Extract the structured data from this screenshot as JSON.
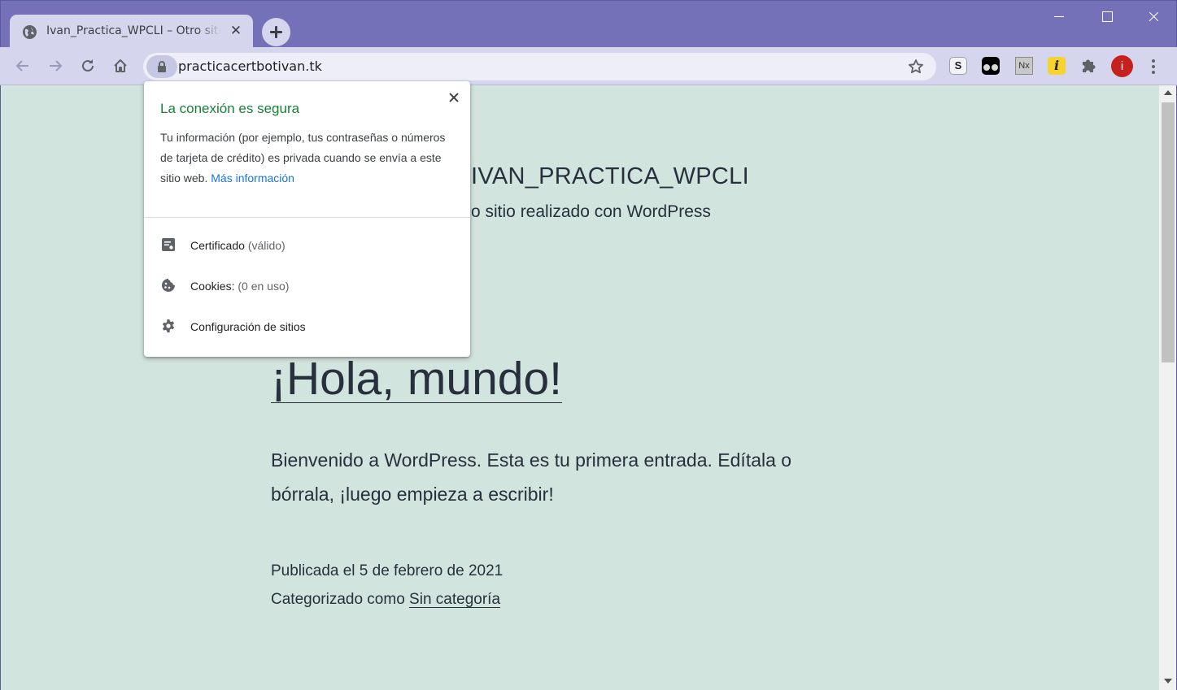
{
  "browser": {
    "tab": {
      "title": "Ivan_Practica_WPCLI – Otro sitio realizado con WordPress",
      "close_glyph": "✕"
    },
    "url": "practicacertbotivan.tk",
    "extensions": {
      "s_label": "S",
      "nx_label": "Nx",
      "i_label": "i"
    },
    "profile_initial": "i",
    "colors": {
      "frame": "#7571b8",
      "toolbar": "#d5d6ee",
      "profile": "#c5221f"
    }
  },
  "popup": {
    "title": "La conexión es segura",
    "description": "Tu información (por ejemplo, tus contraseñas o números de tarjeta de crédito) es privada cuando se envía a este sitio web.",
    "link": "Más información",
    "rows": {
      "certificate": {
        "label": "Certificado",
        "sub": "(válido)"
      },
      "cookies": {
        "label": "Cookies:",
        "sub": "(0 en uso)"
      },
      "site_settings": {
        "label": "Configuración de sitios"
      }
    },
    "colors": {
      "title": "#188038",
      "link": "#1a73e8"
    }
  },
  "site": {
    "title_visible": "IVAN_PRACTICA_WPCLI",
    "description_visible": "o sitio realizado con WordPress",
    "post_title": "¡Hola, mundo!",
    "post_body": "Bienvenido a WordPress. Esta es tu primera entrada. Edítala o bórrala, ¡luego empieza a escribir!",
    "published": "Publicada el 5 de febrero de 2021",
    "category_prefix": "Categorizado como",
    "category_link": "Sin categoría",
    "colors": {
      "background": "#d1e4dd",
      "text": "#28303d"
    }
  }
}
